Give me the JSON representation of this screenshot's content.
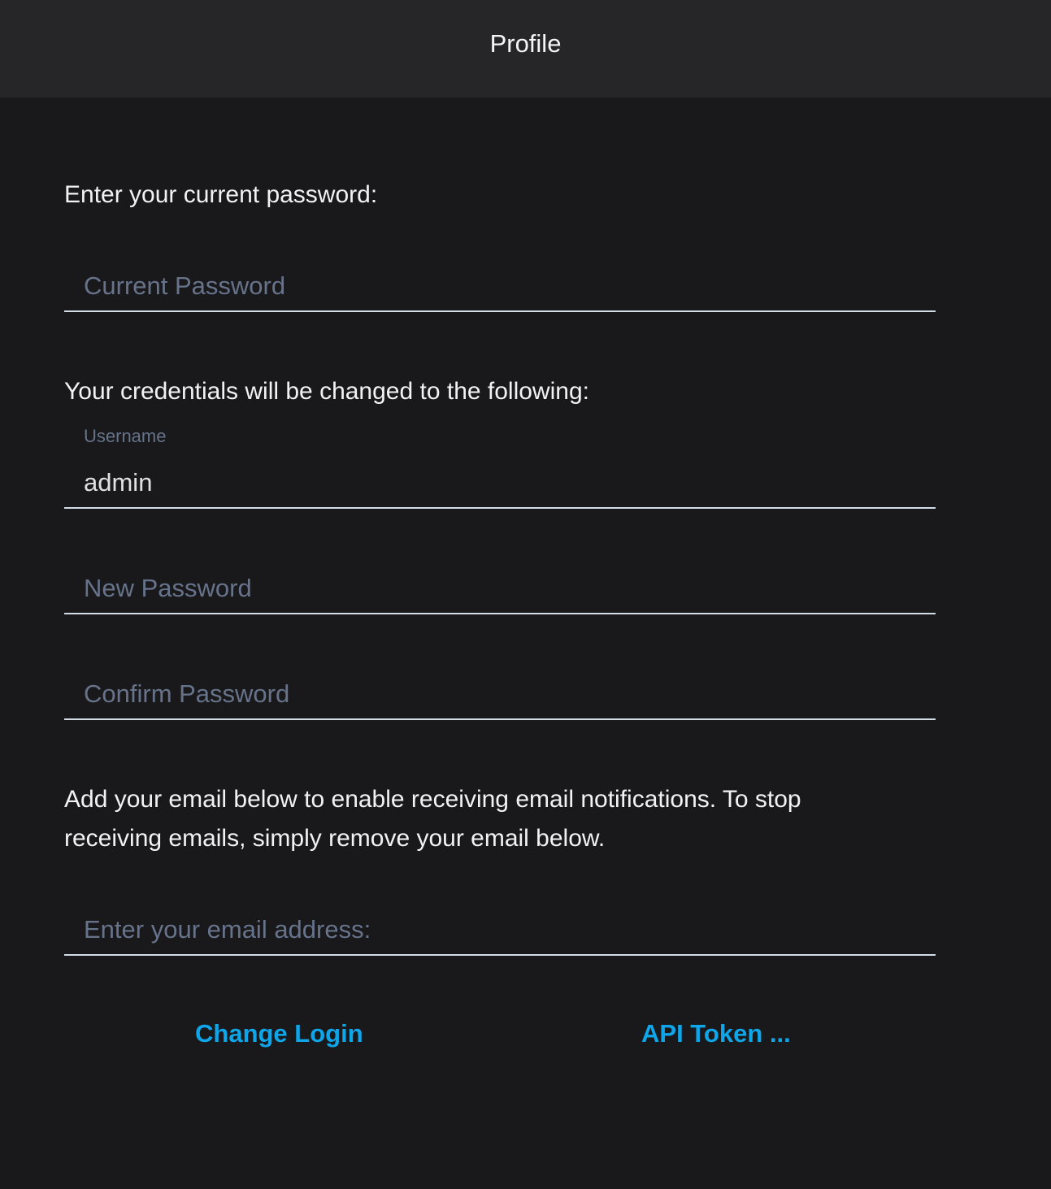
{
  "header": {
    "title": "Profile"
  },
  "form": {
    "current_prompt": "Enter your current password:",
    "current_password": {
      "placeholder": "Current Password",
      "value": ""
    },
    "credentials_prompt": "Your credentials will be changed to the following:",
    "username": {
      "label": "Username",
      "value": "admin"
    },
    "new_password": {
      "placeholder": "New Password",
      "value": ""
    },
    "confirm_password": {
      "placeholder": "Confirm Password",
      "value": ""
    },
    "email_prompt": "Add your email below to enable receiving email notifications. To stop receiving emails, simply remove your email below.",
    "email": {
      "placeholder": "Enter your email address:",
      "value": ""
    }
  },
  "actions": {
    "change_login": "Change Login",
    "api_token": "API Token ..."
  },
  "colors": {
    "accent": "#0ea5e9",
    "background": "#19191b",
    "header": "#262628"
  }
}
